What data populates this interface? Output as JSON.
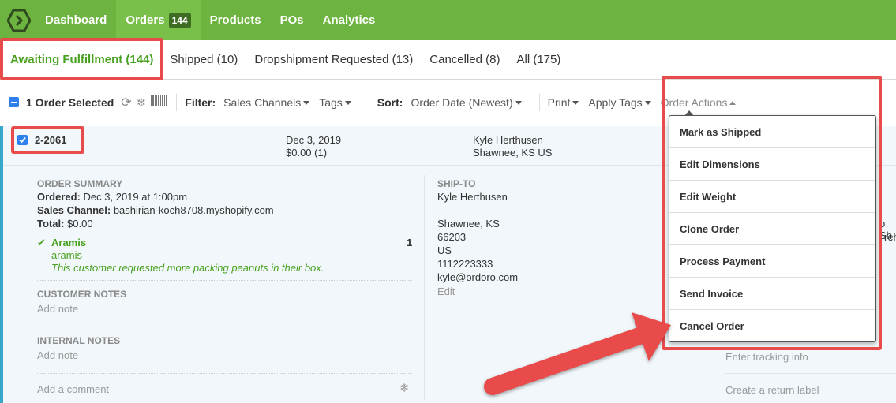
{
  "nav": {
    "items": [
      {
        "label": "Dashboard"
      },
      {
        "label": "Orders",
        "badge": "144"
      },
      {
        "label": "Products"
      },
      {
        "label": "POs"
      },
      {
        "label": "Analytics"
      }
    ]
  },
  "tabs": [
    {
      "label": "Awaiting Fulfillment (144)"
    },
    {
      "label": "Shipped (10)"
    },
    {
      "label": "Dropshipment Requested (13)"
    },
    {
      "label": "Cancelled (8)"
    },
    {
      "label": "All (175)"
    }
  ],
  "toolbar": {
    "selected": "1 Order Selected",
    "filter_label": "Filter:",
    "sales_channels": "Sales Channels",
    "tags": "Tags",
    "sort_label": "Sort:",
    "sort_value": "Order Date (Newest)",
    "print": "Print",
    "apply_tags": "Apply Tags",
    "order_actions": "Order Actions"
  },
  "order": {
    "number": "2-2061",
    "date": "Dec 3, 2019",
    "amount": "$0.00 (1)",
    "customer_name": "Kyle Herthusen",
    "customer_location": "Shawnee, KS US",
    "summary": {
      "title": "ORDER SUMMARY",
      "ordered_label": "Ordered:",
      "ordered_value": "Dec 3, 2019 at 1:00pm",
      "channel_label": "Sales Channel:",
      "channel_value": "bashirian-koch8708.myshopify.com",
      "total_label": "Total:",
      "total_value": "$0.00",
      "line_name": "Aramis",
      "line_sku": "aramis",
      "line_note": "This customer requested more packing peanuts in their box.",
      "line_qty": "1"
    },
    "customer_notes": {
      "title": "CUSTOMER NOTES",
      "add": "Add note"
    },
    "internal_notes": {
      "title": "INTERNAL NOTES",
      "add": "Add note"
    },
    "comment_placeholder": "Add a comment",
    "ship_to": {
      "title": "SHIP-TO",
      "name": "Kyle Herthusen",
      "city": "Shawnee, KS",
      "zip": "66203",
      "country": "US",
      "phone": "1112223333",
      "email": "kyle@ordoro.com",
      "edit": "Edit"
    },
    "right_partial": {
      "sh": "o Sh",
      "reh": "reh",
      "tracking": "Enter tracking info",
      "return_label": "Create a return label"
    }
  },
  "order_actions_menu": [
    {
      "label": "Mark as Shipped"
    },
    {
      "label": "Edit Dimensions"
    },
    {
      "label": "Edit Weight"
    },
    {
      "label": "Clone Order"
    },
    {
      "label": "Process Payment"
    },
    {
      "label": "Send Invoice"
    },
    {
      "label": "Cancel Order"
    }
  ],
  "colors": {
    "nav_green": "#6cb33f",
    "active_tab_green": "#47a11e",
    "highlight_red": "#e94b4b",
    "order_accent": "#38a8c9"
  }
}
